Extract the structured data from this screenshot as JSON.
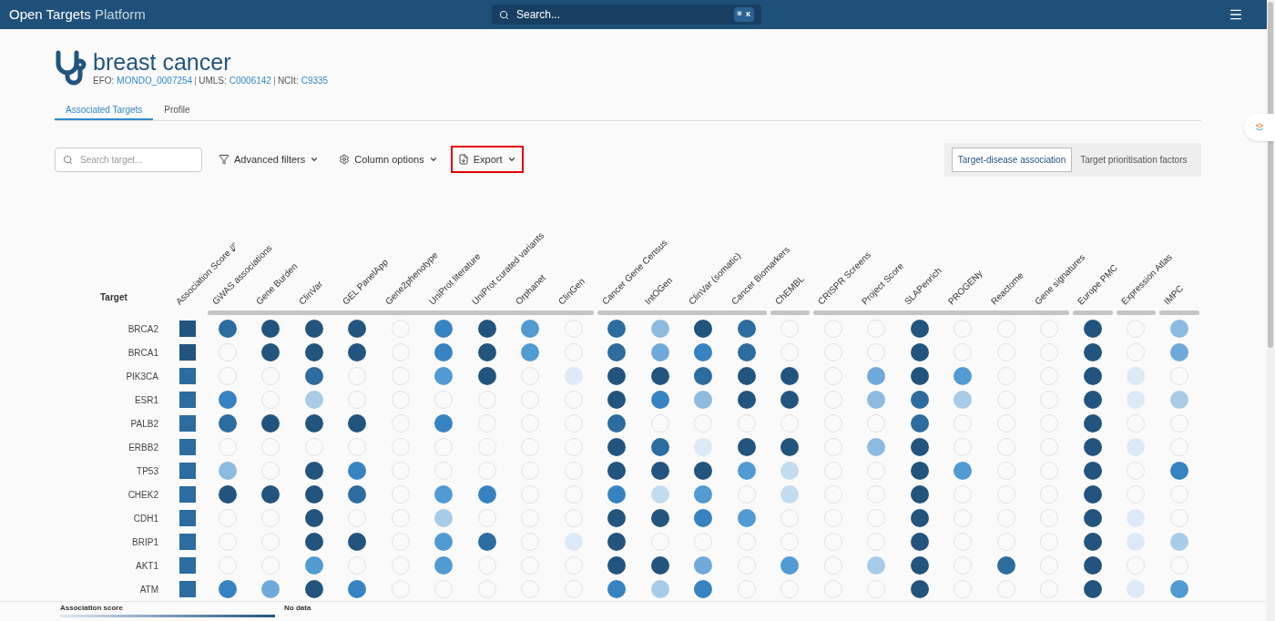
{
  "header": {
    "brand_bold": "Open Targets",
    "brand_light": "Platform",
    "search_placeholder": "Search...",
    "shortcut": "⌘ K"
  },
  "disease": {
    "name": "breast cancer",
    "ids": [
      {
        "label": "EFO:",
        "value": "MONDO_0007254"
      },
      {
        "label": "UMLS:",
        "value": "C0006142"
      },
      {
        "label": "NCIt:",
        "value": "C9335"
      }
    ]
  },
  "tabs": [
    {
      "label": "Associated Targets",
      "selected": true
    },
    {
      "label": "Profile",
      "selected": false
    }
  ],
  "toolbar": {
    "search_placeholder": "Search target...",
    "buttons": [
      {
        "label": "Advanced filters",
        "highlighted": false
      },
      {
        "label": "Column options",
        "highlighted": false
      },
      {
        "label": "Export",
        "highlighted": true
      }
    ]
  },
  "view_toggle": [
    {
      "label": "Target-disease association",
      "selected": true
    },
    {
      "label": "Target prioritisation factors",
      "selected": false
    }
  ],
  "table": {
    "target_header": "Target",
    "score_header": {
      "label": "Association Score",
      "sorted": true
    },
    "column_groups": [
      {
        "columns": [
          "GWAS associations",
          "Gene Burden",
          "ClinVar",
          "GEL PanelApp",
          "Gene2phenotype",
          "UniProt literature",
          "UniProt curated variants",
          "Orphanet",
          "ClinGen"
        ]
      },
      {
        "columns": [
          "Cancer Gene Census",
          "IntOGen",
          "ClinVar (somatic)",
          "Cancer Biomarkers"
        ]
      },
      {
        "columns": [
          "ChEMBL"
        ]
      },
      {
        "columns": [
          "CRISPR Screens",
          "Project Score",
          "SLAPenrich",
          "PROGENy",
          "Reactome",
          "Gene signatures"
        ]
      },
      {
        "columns": [
          "Europe PMC"
        ]
      },
      {
        "columns": [
          "Expression Atlas"
        ]
      },
      {
        "columns": [
          "IMPC"
        ]
      }
    ],
    "rows": [
      {
        "target": "BRCA2",
        "score": {
          "color": "#23547e"
        },
        "cells": [
          {
            "kind": "dot",
            "color": "#2c6c9f"
          },
          {
            "kind": "dot",
            "color": "#23547e"
          },
          {
            "kind": "dot",
            "color": "#23547e"
          },
          {
            "kind": "dot",
            "color": "#23547e"
          },
          {
            "kind": "empty"
          },
          {
            "kind": "dot",
            "color": "#3783c2"
          },
          {
            "kind": "dot",
            "color": "#23547e"
          },
          {
            "kind": "dot",
            "color": "#519ad2"
          },
          {
            "kind": "empty"
          },
          {
            "kind": "dot",
            "color": "#2c6c9f"
          },
          {
            "kind": "dot",
            "color": "#8dbbe0"
          },
          {
            "kind": "dot",
            "color": "#23547e"
          },
          {
            "kind": "dot",
            "color": "#2c6c9f"
          },
          {
            "kind": "empty"
          },
          {
            "kind": "empty"
          },
          {
            "kind": "empty"
          },
          {
            "kind": "dot",
            "color": "#23547e"
          },
          {
            "kind": "empty"
          },
          {
            "kind": "empty"
          },
          {
            "kind": "empty"
          },
          {
            "kind": "dot",
            "color": "#23547e"
          },
          {
            "kind": "empty"
          },
          {
            "kind": "dot",
            "color": "#8dbbe0"
          }
        ]
      },
      {
        "target": "BRCA1",
        "score": {
          "color": "#23547e"
        },
        "cells": [
          {
            "kind": "empty"
          },
          {
            "kind": "dot",
            "color": "#23547e"
          },
          {
            "kind": "dot",
            "color": "#23547e"
          },
          {
            "kind": "dot",
            "color": "#23547e"
          },
          {
            "kind": "empty"
          },
          {
            "kind": "dot",
            "color": "#3783c2"
          },
          {
            "kind": "dot",
            "color": "#23547e"
          },
          {
            "kind": "dot",
            "color": "#519ad2"
          },
          {
            "kind": "empty"
          },
          {
            "kind": "dot",
            "color": "#2c6c9f"
          },
          {
            "kind": "dot",
            "color": "#6fa9da"
          },
          {
            "kind": "dot",
            "color": "#3783c2"
          },
          {
            "kind": "dot",
            "color": "#2c6c9f"
          },
          {
            "kind": "empty"
          },
          {
            "kind": "empty"
          },
          {
            "kind": "empty"
          },
          {
            "kind": "dot",
            "color": "#23547e"
          },
          {
            "kind": "empty"
          },
          {
            "kind": "empty"
          },
          {
            "kind": "empty"
          },
          {
            "kind": "dot",
            "color": "#23547e"
          },
          {
            "kind": "empty"
          },
          {
            "kind": "dot",
            "color": "#6fa9da"
          }
        ]
      },
      {
        "target": "PIK3CA",
        "score": {
          "color": "#2c6c9f"
        },
        "cells": [
          {
            "kind": "empty"
          },
          {
            "kind": "empty"
          },
          {
            "kind": "dot",
            "color": "#2c6c9f"
          },
          {
            "kind": "empty"
          },
          {
            "kind": "empty"
          },
          {
            "kind": "dot",
            "color": "#519ad2"
          },
          {
            "kind": "dot",
            "color": "#23547e"
          },
          {
            "kind": "empty"
          },
          {
            "kind": "dot",
            "color": "#dde9f6"
          },
          {
            "kind": "dot",
            "color": "#23547e"
          },
          {
            "kind": "dot",
            "color": "#23547e"
          },
          {
            "kind": "dot",
            "color": "#2c6c9f"
          },
          {
            "kind": "dot",
            "color": "#23547e"
          },
          {
            "kind": "dot",
            "color": "#23547e"
          },
          {
            "kind": "empty"
          },
          {
            "kind": "dot",
            "color": "#6fa9da"
          },
          {
            "kind": "dot",
            "color": "#23547e"
          },
          {
            "kind": "dot",
            "color": "#519ad2"
          },
          {
            "kind": "empty"
          },
          {
            "kind": "empty"
          },
          {
            "kind": "dot",
            "color": "#23547e"
          },
          {
            "kind": "dot",
            "color": "#dde9f6"
          },
          {
            "kind": "empty"
          }
        ]
      },
      {
        "target": "ESR1",
        "score": {
          "color": "#2c6c9f"
        },
        "cells": [
          {
            "kind": "dot",
            "color": "#3783c2"
          },
          {
            "kind": "empty"
          },
          {
            "kind": "dot",
            "color": "#a8cbe7"
          },
          {
            "kind": "empty"
          },
          {
            "kind": "empty"
          },
          {
            "kind": "empty"
          },
          {
            "kind": "empty"
          },
          {
            "kind": "empty"
          },
          {
            "kind": "empty"
          },
          {
            "kind": "dot",
            "color": "#23547e"
          },
          {
            "kind": "dot",
            "color": "#3783c2"
          },
          {
            "kind": "dot",
            "color": "#8dbbe0"
          },
          {
            "kind": "dot",
            "color": "#23547e"
          },
          {
            "kind": "dot",
            "color": "#23547e"
          },
          {
            "kind": "empty"
          },
          {
            "kind": "dot",
            "color": "#8dbbe0"
          },
          {
            "kind": "dot",
            "color": "#2c6c9f"
          },
          {
            "kind": "dot",
            "color": "#a8cbe7"
          },
          {
            "kind": "empty"
          },
          {
            "kind": "empty"
          },
          {
            "kind": "dot",
            "color": "#23547e"
          },
          {
            "kind": "dot",
            "color": "#dde9f6"
          },
          {
            "kind": "dot",
            "color": "#a8cbe7"
          }
        ]
      },
      {
        "target": "PALB2",
        "score": {
          "color": "#2c6c9f"
        },
        "cells": [
          {
            "kind": "dot",
            "color": "#2c6c9f"
          },
          {
            "kind": "dot",
            "color": "#23547e"
          },
          {
            "kind": "dot",
            "color": "#23547e"
          },
          {
            "kind": "dot",
            "color": "#23547e"
          },
          {
            "kind": "empty"
          },
          {
            "kind": "dot",
            "color": "#3783c2"
          },
          {
            "kind": "empty"
          },
          {
            "kind": "empty"
          },
          {
            "kind": "empty"
          },
          {
            "kind": "dot",
            "color": "#2c6c9f"
          },
          {
            "kind": "empty"
          },
          {
            "kind": "empty"
          },
          {
            "kind": "empty"
          },
          {
            "kind": "empty"
          },
          {
            "kind": "empty"
          },
          {
            "kind": "empty"
          },
          {
            "kind": "dot",
            "color": "#2c6c9f"
          },
          {
            "kind": "empty"
          },
          {
            "kind": "empty"
          },
          {
            "kind": "empty"
          },
          {
            "kind": "dot",
            "color": "#23547e"
          },
          {
            "kind": "empty"
          },
          {
            "kind": "empty"
          }
        ]
      },
      {
        "target": "ERBB2",
        "score": {
          "color": "#2c6c9f"
        },
        "cells": [
          {
            "kind": "empty"
          },
          {
            "kind": "empty"
          },
          {
            "kind": "empty"
          },
          {
            "kind": "empty"
          },
          {
            "kind": "empty"
          },
          {
            "kind": "empty"
          },
          {
            "kind": "empty"
          },
          {
            "kind": "empty"
          },
          {
            "kind": "empty"
          },
          {
            "kind": "dot",
            "color": "#23547e"
          },
          {
            "kind": "dot",
            "color": "#2c6c9f"
          },
          {
            "kind": "dot",
            "color": "#dde9f6"
          },
          {
            "kind": "dot",
            "color": "#23547e"
          },
          {
            "kind": "dot",
            "color": "#23547e"
          },
          {
            "kind": "empty"
          },
          {
            "kind": "dot",
            "color": "#8dbbe0"
          },
          {
            "kind": "dot",
            "color": "#23547e"
          },
          {
            "kind": "empty"
          },
          {
            "kind": "empty"
          },
          {
            "kind": "empty"
          },
          {
            "kind": "dot",
            "color": "#23547e"
          },
          {
            "kind": "dot",
            "color": "#dde9f6"
          },
          {
            "kind": "empty"
          }
        ]
      },
      {
        "target": "TP53",
        "score": {
          "color": "#2c6c9f"
        },
        "cells": [
          {
            "kind": "dot",
            "color": "#8dbbe0"
          },
          {
            "kind": "empty"
          },
          {
            "kind": "dot",
            "color": "#23547e"
          },
          {
            "kind": "dot",
            "color": "#3783c2"
          },
          {
            "kind": "empty"
          },
          {
            "kind": "empty"
          },
          {
            "kind": "empty"
          },
          {
            "kind": "empty"
          },
          {
            "kind": "empty"
          },
          {
            "kind": "dot",
            "color": "#23547e"
          },
          {
            "kind": "dot",
            "color": "#23547e"
          },
          {
            "kind": "dot",
            "color": "#23547e"
          },
          {
            "kind": "dot",
            "color": "#519ad2"
          },
          {
            "kind": "dot",
            "color": "#c2dbef"
          },
          {
            "kind": "empty"
          },
          {
            "kind": "empty"
          },
          {
            "kind": "dot",
            "color": "#23547e"
          },
          {
            "kind": "dot",
            "color": "#519ad2"
          },
          {
            "kind": "empty"
          },
          {
            "kind": "empty"
          },
          {
            "kind": "dot",
            "color": "#23547e"
          },
          {
            "kind": "empty"
          },
          {
            "kind": "dot",
            "color": "#3783c2"
          }
        ]
      },
      {
        "target": "CHEK2",
        "score": {
          "color": "#2c6c9f"
        },
        "cells": [
          {
            "kind": "dot",
            "color": "#23547e"
          },
          {
            "kind": "dot",
            "color": "#23547e"
          },
          {
            "kind": "dot",
            "color": "#23547e"
          },
          {
            "kind": "dot",
            "color": "#2c6c9f"
          },
          {
            "kind": "empty"
          },
          {
            "kind": "dot",
            "color": "#519ad2"
          },
          {
            "kind": "dot",
            "color": "#3783c2"
          },
          {
            "kind": "empty"
          },
          {
            "kind": "empty"
          },
          {
            "kind": "dot",
            "color": "#3783c2"
          },
          {
            "kind": "dot",
            "color": "#c2dbef"
          },
          {
            "kind": "dot",
            "color": "#519ad2"
          },
          {
            "kind": "empty"
          },
          {
            "kind": "dot",
            "color": "#c2dbef"
          },
          {
            "kind": "empty"
          },
          {
            "kind": "empty"
          },
          {
            "kind": "dot",
            "color": "#23547e"
          },
          {
            "kind": "empty"
          },
          {
            "kind": "empty"
          },
          {
            "kind": "empty"
          },
          {
            "kind": "dot",
            "color": "#23547e"
          },
          {
            "kind": "empty"
          },
          {
            "kind": "empty"
          }
        ]
      },
      {
        "target": "CDH1",
        "score": {
          "color": "#2c6c9f"
        },
        "cells": [
          {
            "kind": "empty"
          },
          {
            "kind": "empty"
          },
          {
            "kind": "dot",
            "color": "#23547e"
          },
          {
            "kind": "empty"
          },
          {
            "kind": "empty"
          },
          {
            "kind": "dot",
            "color": "#a8cbe7"
          },
          {
            "kind": "empty"
          },
          {
            "kind": "empty"
          },
          {
            "kind": "empty"
          },
          {
            "kind": "dot",
            "color": "#23547e"
          },
          {
            "kind": "dot",
            "color": "#23547e"
          },
          {
            "kind": "dot",
            "color": "#3783c2"
          },
          {
            "kind": "dot",
            "color": "#519ad2"
          },
          {
            "kind": "empty"
          },
          {
            "kind": "empty"
          },
          {
            "kind": "empty"
          },
          {
            "kind": "dot",
            "color": "#23547e"
          },
          {
            "kind": "empty"
          },
          {
            "kind": "empty"
          },
          {
            "kind": "empty"
          },
          {
            "kind": "dot",
            "color": "#23547e"
          },
          {
            "kind": "dot",
            "color": "#dde9f6"
          },
          {
            "kind": "empty"
          }
        ]
      },
      {
        "target": "BRIP1",
        "score": {
          "color": "#2c6c9f"
        },
        "cells": [
          {
            "kind": "empty"
          },
          {
            "kind": "empty"
          },
          {
            "kind": "dot",
            "color": "#23547e"
          },
          {
            "kind": "dot",
            "color": "#23547e"
          },
          {
            "kind": "empty"
          },
          {
            "kind": "dot",
            "color": "#519ad2"
          },
          {
            "kind": "dot",
            "color": "#2c6c9f"
          },
          {
            "kind": "empty"
          },
          {
            "kind": "dot",
            "color": "#dde9f6"
          },
          {
            "kind": "dot",
            "color": "#23547e"
          },
          {
            "kind": "empty"
          },
          {
            "kind": "empty"
          },
          {
            "kind": "empty"
          },
          {
            "kind": "empty"
          },
          {
            "kind": "empty"
          },
          {
            "kind": "empty"
          },
          {
            "kind": "dot",
            "color": "#23547e"
          },
          {
            "kind": "empty"
          },
          {
            "kind": "empty"
          },
          {
            "kind": "empty"
          },
          {
            "kind": "dot",
            "color": "#23547e"
          },
          {
            "kind": "dot",
            "color": "#dde9f6"
          },
          {
            "kind": "dot",
            "color": "#a8cbe7"
          }
        ]
      },
      {
        "target": "AKT1",
        "score": {
          "color": "#2c6c9f"
        },
        "cells": [
          {
            "kind": "empty"
          },
          {
            "kind": "empty"
          },
          {
            "kind": "dot",
            "color": "#519ad2"
          },
          {
            "kind": "empty"
          },
          {
            "kind": "empty"
          },
          {
            "kind": "dot",
            "color": "#519ad2"
          },
          {
            "kind": "empty"
          },
          {
            "kind": "empty"
          },
          {
            "kind": "empty"
          },
          {
            "kind": "dot",
            "color": "#23547e"
          },
          {
            "kind": "dot",
            "color": "#23547e"
          },
          {
            "kind": "dot",
            "color": "#6fa9da"
          },
          {
            "kind": "empty"
          },
          {
            "kind": "dot",
            "color": "#519ad2"
          },
          {
            "kind": "empty"
          },
          {
            "kind": "dot",
            "color": "#a8cbe7"
          },
          {
            "kind": "dot",
            "color": "#23547e"
          },
          {
            "kind": "empty"
          },
          {
            "kind": "dot",
            "color": "#2c6c9f"
          },
          {
            "kind": "empty"
          },
          {
            "kind": "dot",
            "color": "#23547e"
          },
          {
            "kind": "empty"
          },
          {
            "kind": "empty"
          }
        ]
      },
      {
        "target": "ATM",
        "score": {
          "color": "#2c6c9f"
        },
        "cells": [
          {
            "kind": "dot",
            "color": "#3783c2"
          },
          {
            "kind": "dot",
            "color": "#6fa9da"
          },
          {
            "kind": "dot",
            "color": "#23547e"
          },
          {
            "kind": "dot",
            "color": "#3783c2"
          },
          {
            "kind": "empty"
          },
          {
            "kind": "empty"
          },
          {
            "kind": "empty"
          },
          {
            "kind": "empty"
          },
          {
            "kind": "empty"
          },
          {
            "kind": "dot",
            "color": "#3783c2"
          },
          {
            "kind": "dot",
            "color": "#a8cbe7"
          },
          {
            "kind": "dot",
            "color": "#3783c2"
          },
          {
            "kind": "empty"
          },
          {
            "kind": "empty"
          },
          {
            "kind": "empty"
          },
          {
            "kind": "empty"
          },
          {
            "kind": "dot",
            "color": "#23547e"
          },
          {
            "kind": "empty"
          },
          {
            "kind": "empty"
          },
          {
            "kind": "empty"
          },
          {
            "kind": "dot",
            "color": "#23547e"
          },
          {
            "kind": "dot",
            "color": "#dde9f6"
          },
          {
            "kind": "dot",
            "color": "#519ad2"
          }
        ]
      }
    ]
  },
  "legend": {
    "score_label": "Association score",
    "no_data_label": "No data"
  }
}
